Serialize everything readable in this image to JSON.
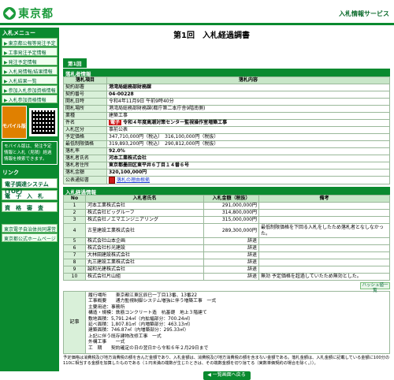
{
  "header": {
    "logo_text": "東京都",
    "service_label": "入札情報サービス"
  },
  "sidebar": {
    "menu_heading": "入札メニュー",
    "items": [
      "東京都公報等発注予定",
      "工事発注予定情報",
      "発注予定情報",
      "入札発情報/結果情報",
      "入札結果一覧",
      "参加入札参加資格情報",
      "入札参加資格情報"
    ],
    "mobile_label": "モバイル版",
    "mobile_note": "モバイル版は、発注予定情報と入札（見積）経過情報を検索できます。",
    "links_heading": "リンク",
    "link_buttons": [
      "電子調達システム(TOP)",
      "電　子　入　札",
      "資　格　審　査"
    ],
    "bottom_links": [
      "東京電子自治体共同運営",
      "東京都公式ホームページ"
    ]
  },
  "main": {
    "page_title": "第1回　入札経過調書",
    "tab_label": "第1回",
    "section1_title": "落札者情報",
    "info_headers": [
      "落札項目",
      "落札内容"
    ],
    "info_rows": [
      {
        "label": "契約部署",
        "value": "港湾局総務部財務課"
      },
      {
        "label": "契約番号",
        "value": "04-00228"
      },
      {
        "label": "開札日時",
        "value": "令和4年11月9日 午前9時40分"
      },
      {
        "label": "開札場所",
        "value": "港湾局総務部財務課(都庁第二本庁舎9階南側)"
      },
      {
        "label": "業種",
        "value": "建築工事"
      },
      {
        "label": "件名",
        "tag": "電子",
        "value": "令和４年度高潮対策センター監視操作室増築工事"
      },
      {
        "label": "入札区分",
        "value": "事前公表"
      },
      {
        "label": "予定価格",
        "value": "347,710,000円（税込）　316,100,000円（税抜）"
      },
      {
        "label": "最低制限価格",
        "value": "319,893,200円（税込）　290,812,000円（税抜）"
      },
      {
        "label": "落札率",
        "value": "92.0%"
      },
      {
        "label": "落札者氏名",
        "value": "河本工業株式会社"
      },
      {
        "label": "落札者住所",
        "value": "東京都墨田区東平井６丁目１４番６号"
      },
      {
        "label": "落札金額",
        "value": "320,100,000円"
      },
      {
        "label": "公表通知書",
        "value": "落札の理由根拠"
      }
    ],
    "section2_title": "入札経過情報",
    "bid_headers": [
      "No",
      "入札者氏名",
      "入札金額（税抜）",
      "備考"
    ],
    "bids": [
      {
        "no": "1",
        "name": "河本工業株式会社",
        "amount": "291,000,000円",
        "note": ""
      },
      {
        "no": "2",
        "name": "株式会社ビッグルーフ",
        "amount": "314,800,000円",
        "note": ""
      },
      {
        "no": "3",
        "name": "株式会社ノエマエンジニアリング",
        "amount": "315,000,000円",
        "note": ""
      },
      {
        "no": "4",
        "name": "古里建設工業株式会社",
        "amount": "289,300,000円",
        "note": "最低制限価格を下回る入札をしたため落札者となしなかった。"
      },
      {
        "no": "5",
        "name": "株式会社山本企画",
        "amount": "辞退",
        "note": ""
      },
      {
        "no": "6",
        "name": "株式会社杉光建設",
        "amount": "辞退",
        "note": ""
      },
      {
        "no": "7",
        "name": "大林田建設株式会社",
        "amount": "辞退",
        "note": ""
      },
      {
        "no": "8",
        "name": "丸三建設工業株式会社",
        "amount": "辞退",
        "note": ""
      },
      {
        "no": "9",
        "name": "誠和光建株式会社",
        "amount": "辞退",
        "note": ""
      },
      {
        "no": "10",
        "name": "株式会社片山組",
        "amount": "辞退",
        "note": "無効 予定価格を超過していたため無効とした。"
      }
    ],
    "detail_button": "ハッシュ値一覧",
    "remarks_label": "記事",
    "remarks_lines": [
      "履行場所　　東京都江東区辰巳一丁目13番、13番22",
      "工事概要　　通力監視制御システム増強に伴う増築工事　一式",
      "主要用途：事務所",
      "構造・規模：鉄筋コンクリート造　杭基礎　地上３階建て",
      "敷地面積：5,791.24㎡（内拡幅部分：700.24㎡）",
      "延べ面積：1,807.81㎡（内増築部分：463.13㎡）",
      "建築面積：746.87㎡（内増築部分：295.33㎡）",
      "上記に伴う既存建物改修工事　一式",
      "外構工事　　一式",
      "工　期　　契約確定の日の翌日から令和６年２月29日まで"
    ],
    "footnote": "予定価格は消費税及び地方消費税の額を含んだ金額であり、入札金額は、消費税及び地方消費税の額を含まない金額である。落札金額は、入札金額に記載している金額に100分の110に相当する金額を加算したものである（１円未満の端数が生じたときは、その端数金額を切り捨てる（実数単価契約の場合を除く。））。",
    "back_button": "◀ 一覧画面へ戻る"
  }
}
